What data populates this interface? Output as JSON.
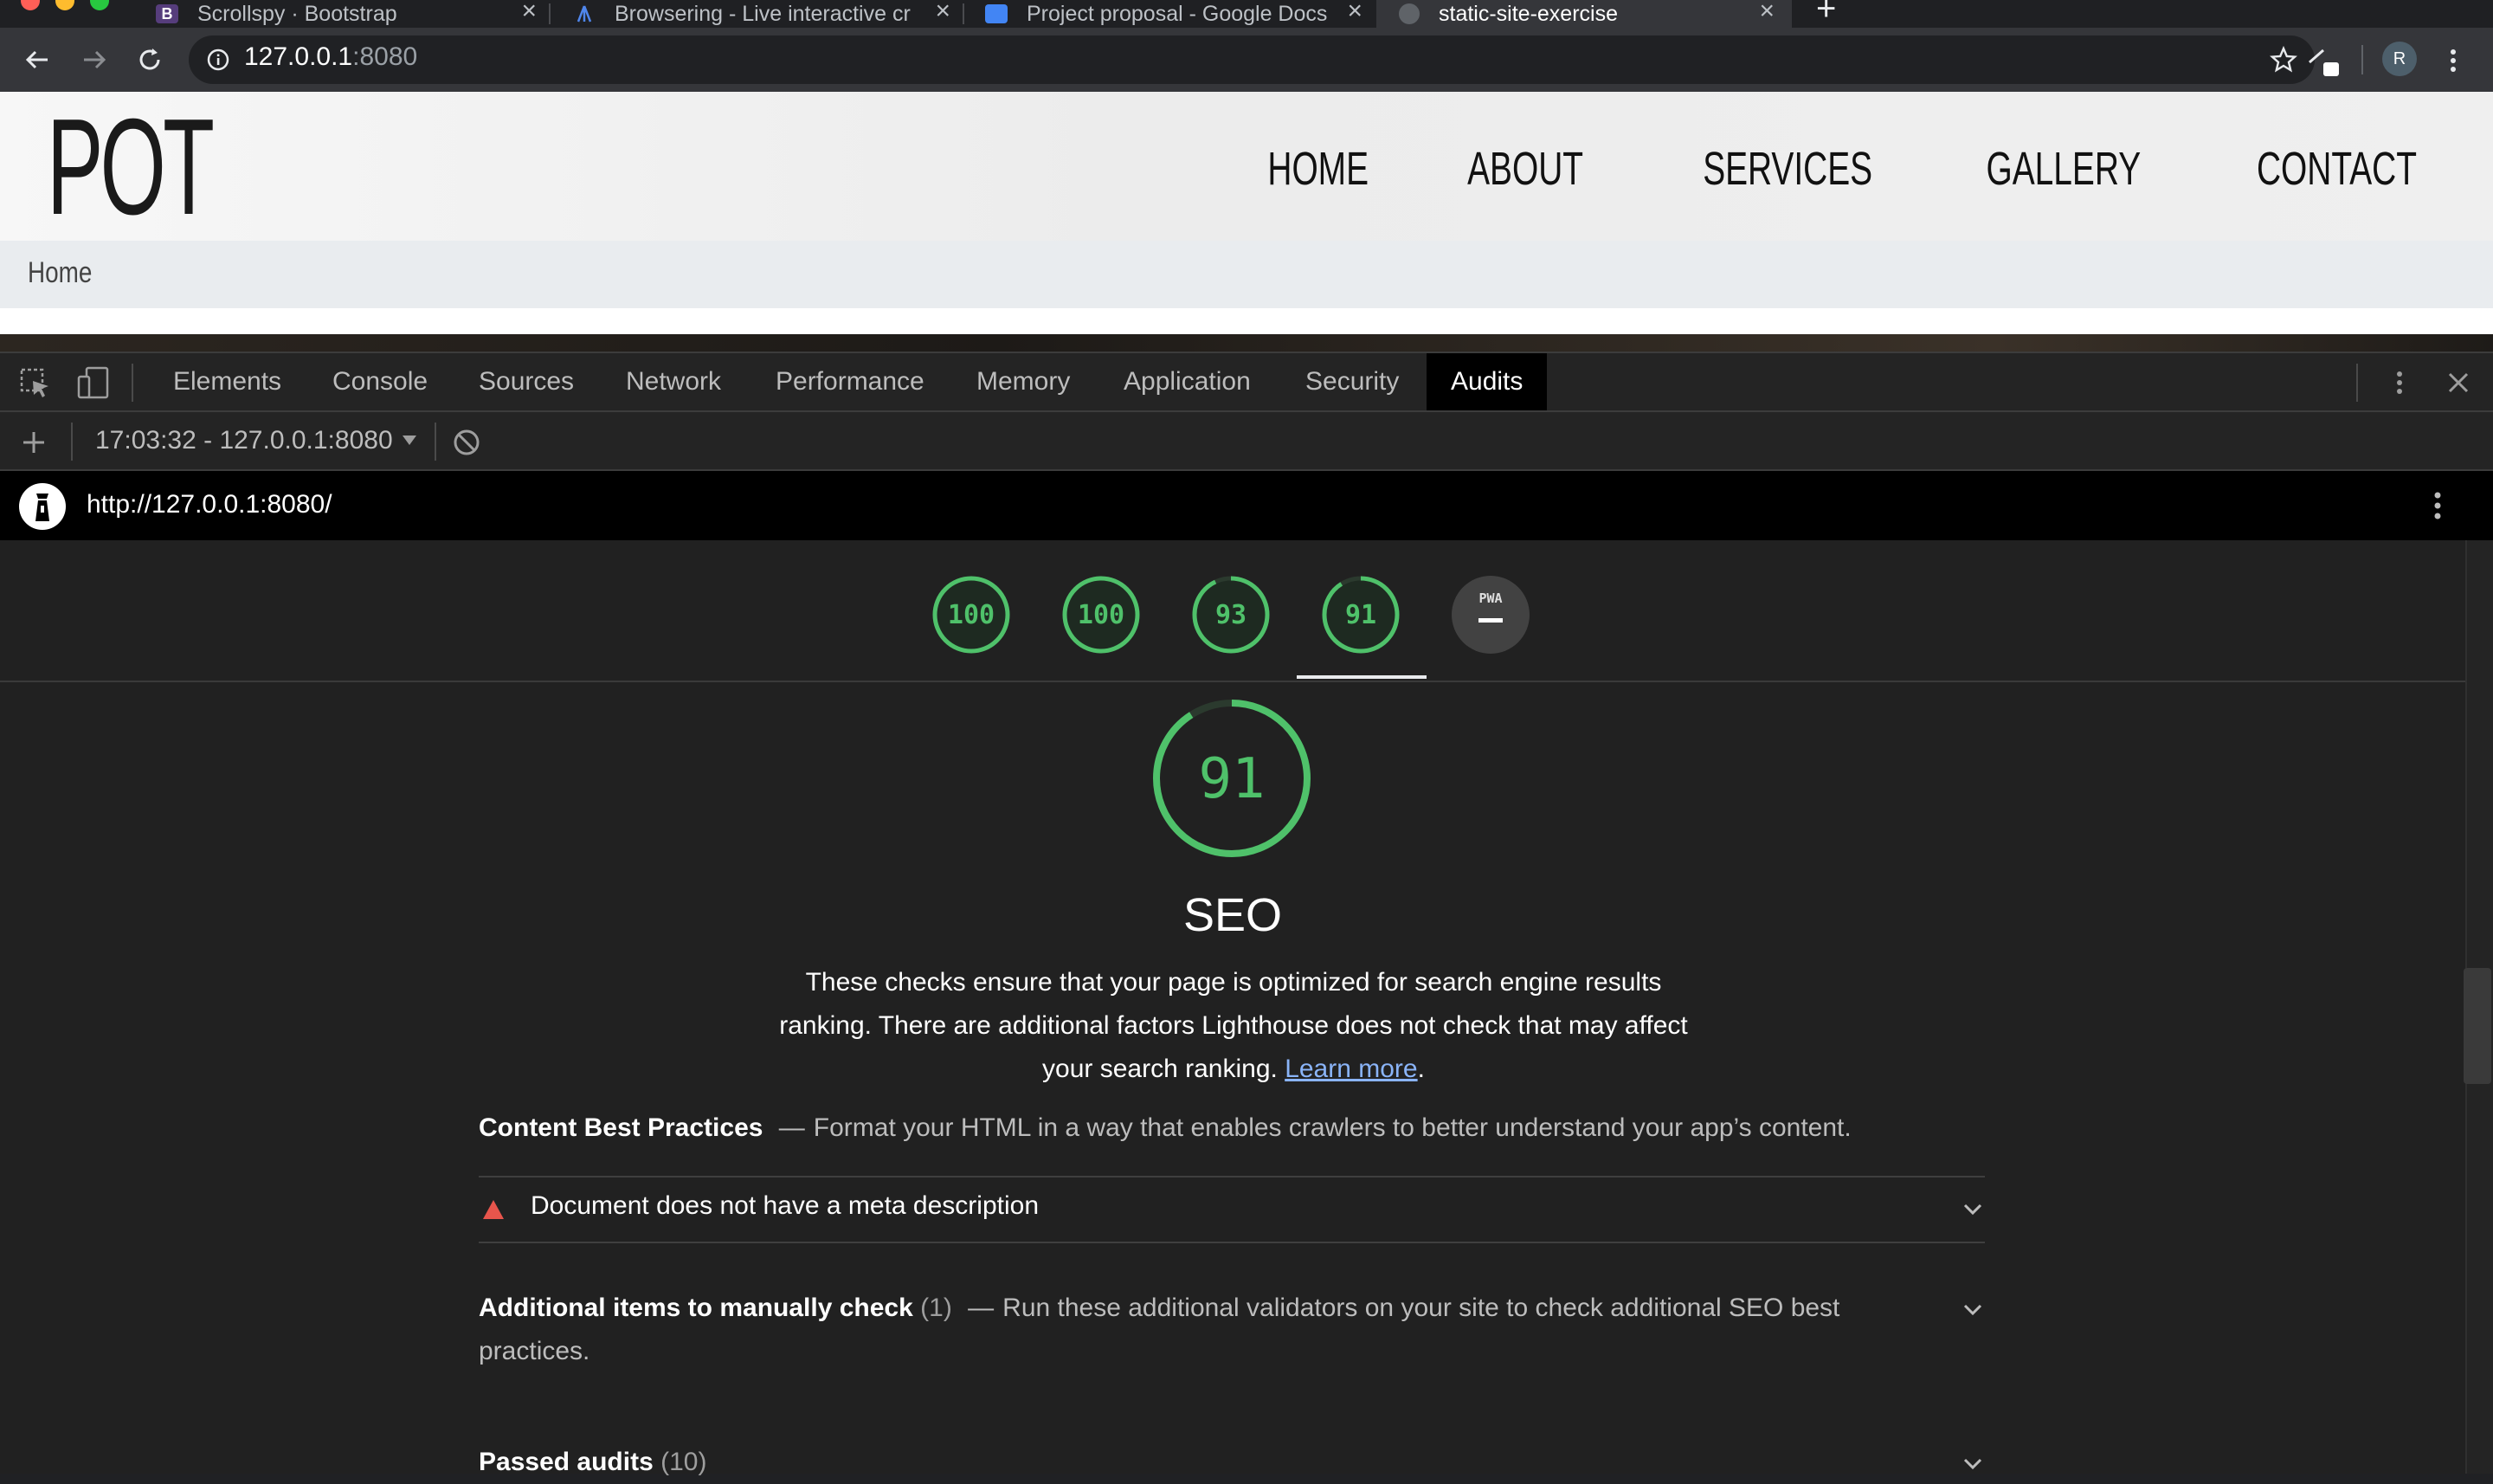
{
  "browser": {
    "tabs": [
      {
        "label": "Scrollspy · Bootstrap",
        "favicon_color": "#563d7c",
        "favicon_letter": "B"
      },
      {
        "label": "Browsering - Live interactive cr",
        "favicon_color": "#2f6bd6",
        "favicon_letter": ""
      },
      {
        "label": "Project proposal - Google Docs",
        "favicon_color": "#4285f4",
        "favicon_letter": ""
      },
      {
        "label": "static-site-exercise",
        "favicon_color": "#5f6368",
        "favicon_letter": ""
      }
    ],
    "new_tab": "+",
    "address": {
      "host": "127.0.0.1",
      "port": ":8080"
    },
    "profile_initial": "R"
  },
  "site": {
    "logo": "POT",
    "nav": [
      "HOME",
      "ABOUT",
      "SERVICES",
      "GALLERY",
      "CONTACT"
    ],
    "breadcrumb": "Home"
  },
  "devtools": {
    "tabs": [
      "Elements",
      "Console",
      "Sources",
      "Network",
      "Performance",
      "Memory",
      "Application",
      "Security",
      "Audits"
    ],
    "active_tab": "Audits",
    "report_selector": "17:03:32 - 127.0.0.1:8080",
    "report_url": "http://127.0.0.1:8080/"
  },
  "lighthouse": {
    "scores": [
      {
        "value": "100",
        "color": "#4fc16a"
      },
      {
        "value": "100",
        "color": "#4fc16a"
      },
      {
        "value": "93",
        "color": "#4fc16a"
      },
      {
        "value": "91",
        "color": "#4fc16a"
      },
      {
        "value": "PWA",
        "color": "#9e9e9e"
      }
    ],
    "selected_score": "91",
    "category_title": "SEO",
    "description_part1": "These checks ensure that your page is optimized for search engine results ranking. There are additional factors Lighthouse does not check that may affect your search ranking. ",
    "learn_more": "Learn more",
    "description_end": ".",
    "groups": {
      "content_title": "Content Best Practices",
      "content_desc": "Format your HTML in a way that enables crawlers to better understand your app’s content.",
      "failing_audit": "Document does not have a meta description",
      "manual_title": "Additional items to manually check",
      "manual_count": "(1)",
      "manual_desc": "Run these additional validators on your site to check additional SEO best practices.",
      "passed_title": "Passed audits",
      "passed_count": "(10)"
    },
    "dash": "—"
  }
}
